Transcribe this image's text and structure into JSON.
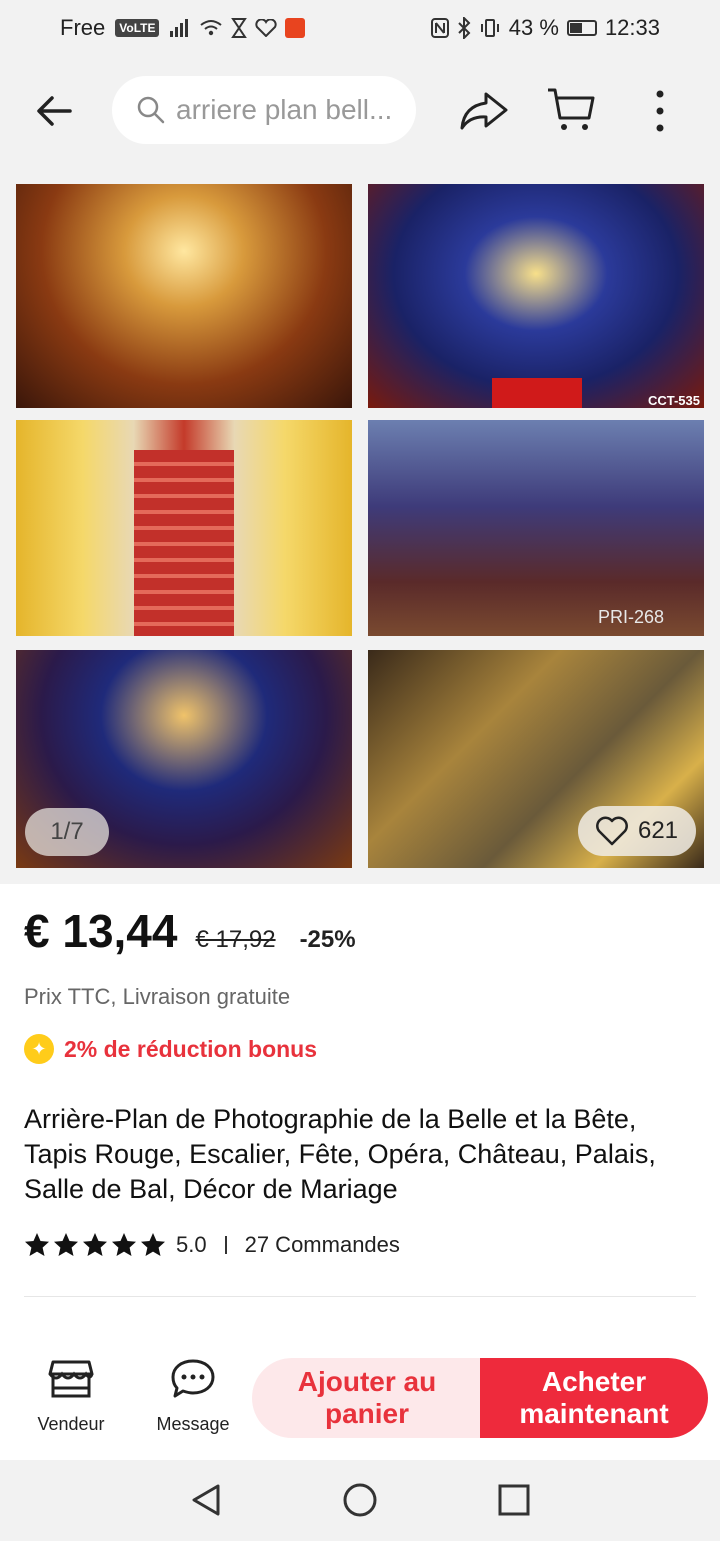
{
  "status_bar": {
    "carrier": "Free",
    "volte": "VoLTE",
    "battery": "43 %",
    "time": "12:33"
  },
  "top_bar": {
    "search_text": "arriere plan bell..."
  },
  "gallery": {
    "code_1": "CCT-535",
    "code_2": "PRI-268",
    "counter": "1/7",
    "likes": "621"
  },
  "product": {
    "price": "€ 13,44",
    "old_price": "€ 17,92",
    "discount": "-25%",
    "tax_note": "Prix TTC, Livraison gratuite",
    "bonus": "2% de réduction bonus",
    "title": "Arrière-Plan de Photographie de la Belle et la Bête, Tapis Rouge, Escalier, Fête, Opéra, Château, Palais, Salle de Bal, Décor de Mariage",
    "rating": "5.0",
    "rating_value": 5,
    "orders": "27 Commandes"
  },
  "actions": {
    "vendor": "Vendeur",
    "message": "Message",
    "add_to_cart": "Ajouter au panier",
    "buy_now": "Acheter maintenant"
  },
  "colors": {
    "accent": "#ee2a3c",
    "accent_light": "#fde8ea",
    "bonus_text": "#e8323c",
    "bonus_icon": "#ffcc1a"
  }
}
